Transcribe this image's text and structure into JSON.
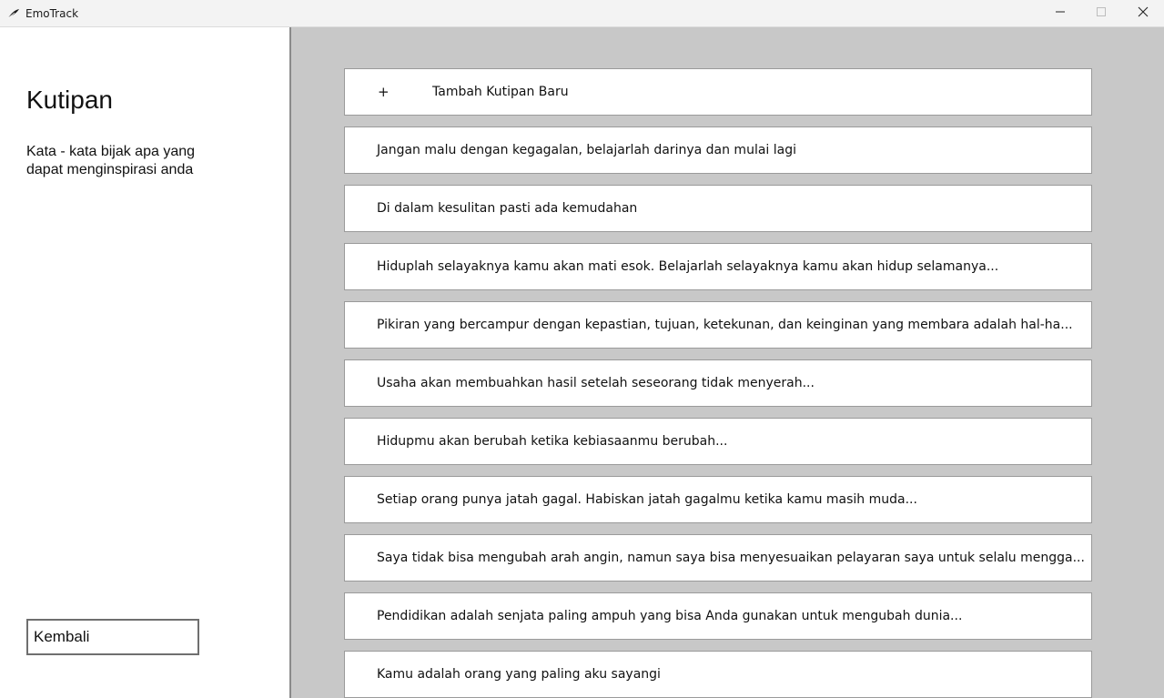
{
  "window": {
    "title": "EmoTrack",
    "app_icon": "feather-icon",
    "controls": {
      "minimize_icon": "minimize-icon",
      "maximize_icon": "maximize-icon",
      "close_icon": "close-icon"
    }
  },
  "sidebar": {
    "title": "Kutipan",
    "subtitle": "Kata - kata bijak apa yang dapat menginspirasi anda",
    "back_label": "Kembali"
  },
  "quotes": {
    "add_icon": "+",
    "add_label": "Tambah Kutipan Baru",
    "items": [
      "Jangan malu dengan kegagalan, belajarlah darinya dan mulai lagi",
      "Di dalam kesulitan pasti ada kemudahan",
      "Hiduplah selayaknya kamu akan mati esok. Belajarlah selayaknya kamu akan hidup selamanya...",
      "Pikiran yang bercampur dengan kepastian, tujuan, ketekunan, dan keinginan yang membara adalah hal-ha...",
      "Usaha akan membuahkan hasil setelah seseorang tidak menyerah...",
      "Hidupmu akan berubah ketika kebiasaanmu berubah...",
      "Setiap orang punya jatah gagal. Habiskan jatah gagalmu ketika kamu masih muda...",
      "Saya tidak bisa mengubah arah angin, namun saya bisa menyesuaikan pelayaran saya untuk selalu mengga...",
      "Pendidikan adalah senjata paling ampuh yang bisa Anda gunakan untuk mengubah dunia...",
      "Kamu adalah orang yang paling aku sayangi"
    ]
  },
  "colors": {
    "main_background": "#c8c8c8",
    "card_background": "#ffffff",
    "card_border": "#9a9a9a"
  }
}
